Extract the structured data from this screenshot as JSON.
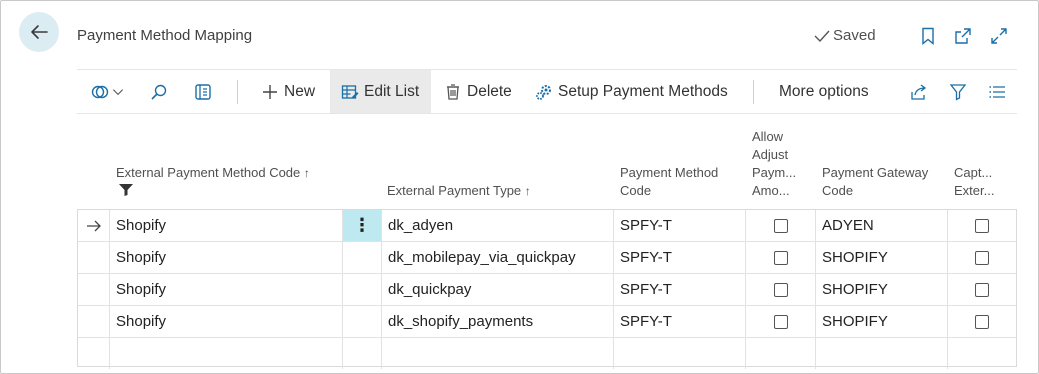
{
  "header": {
    "title": "Payment Method Mapping",
    "saved_label": "Saved"
  },
  "toolbar": {
    "new_label": "New",
    "edit_list_label": "Edit List",
    "delete_label": "Delete",
    "setup_label": "Setup Payment Methods",
    "more_label": "More options"
  },
  "columns": {
    "ext_code": "External Payment Method Code",
    "ext_code_sort": "↑",
    "ext_type": "External Payment Type",
    "ext_type_sort": "↑",
    "pm_code_l1": "Payment Method",
    "pm_code_l2": "Code",
    "allow_l1": "Allow",
    "allow_l2": "Adjust",
    "allow_l3": "Paym...",
    "allow_l4": "Amo...",
    "gateway_l1": "Payment Gateway",
    "gateway_l2": "Code",
    "capt_l1": "Capt...",
    "capt_l2": "Exter..."
  },
  "rows": [
    {
      "ext_code": "Shopify",
      "ext_type": "dk_adyen",
      "pm_code": "SPFY-T",
      "allow_adjust": false,
      "gateway": "ADYEN",
      "capture": false
    },
    {
      "ext_code": "Shopify",
      "ext_type": "dk_mobilepay_via_quickpay",
      "pm_code": "SPFY-T",
      "allow_adjust": false,
      "gateway": "SHOPIFY",
      "capture": false
    },
    {
      "ext_code": "Shopify",
      "ext_type": "dk_quickpay",
      "pm_code": "SPFY-T",
      "allow_adjust": false,
      "gateway": "SHOPIFY",
      "capture": false
    },
    {
      "ext_code": "Shopify",
      "ext_type": "dk_shopify_payments",
      "pm_code": "SPFY-T",
      "allow_adjust": false,
      "gateway": "SHOPIFY",
      "capture": false
    }
  ],
  "icons": {
    "back": "back-arrow-icon",
    "saved": "checkmark-icon",
    "bookmark": "bookmark-icon",
    "open_new": "open-in-new-window-icon",
    "expand": "expand-icon",
    "views": "views-icon",
    "search": "search-icon",
    "filter_pane": "filter-pane-icon",
    "new": "plus-icon",
    "edit_list": "edit-list-icon",
    "delete": "trash-icon",
    "setup": "setup-icon",
    "share": "share-icon",
    "filter": "filter-icon",
    "list": "list-icon",
    "row_indicator": "arrow-right-icon",
    "row_menu": "more-vertical-icon"
  },
  "colors": {
    "accent": "#dcecf3",
    "row_menu_bg": "#bfe9f0"
  }
}
